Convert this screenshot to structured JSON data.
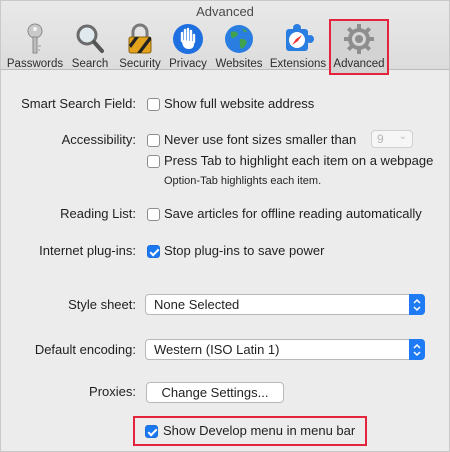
{
  "window": {
    "title": "Advanced"
  },
  "toolbar": {
    "items": [
      {
        "label": "Passwords",
        "icon": "key-icon"
      },
      {
        "label": "Search",
        "icon": "magnifier-icon"
      },
      {
        "label": "Security",
        "icon": "padlock-icon"
      },
      {
        "label": "Privacy",
        "icon": "hand-icon"
      },
      {
        "label": "Websites",
        "icon": "globe-icon"
      },
      {
        "label": "Extensions",
        "icon": "puzzle-compass-icon"
      },
      {
        "label": "Advanced",
        "icon": "gear-icon",
        "selected": true
      }
    ]
  },
  "settings": {
    "smart_search": {
      "label": "Smart Search Field:",
      "option": "Show full website address",
      "checked": false
    },
    "accessibility": {
      "label": "Accessibility:",
      "font_option": "Never use font sizes smaller than",
      "font_size_value": "9",
      "font_checked": false,
      "tab_option": "Press Tab to highlight each item on a webpage",
      "tab_checked": false,
      "tab_hint": "Option-Tab highlights each item."
    },
    "reading_list": {
      "label": "Reading List:",
      "option": "Save articles for offline reading automatically",
      "checked": false
    },
    "plugins": {
      "label": "Internet plug-ins:",
      "option": "Stop plug-ins to save power",
      "checked": true
    },
    "style_sheet": {
      "label": "Style sheet:",
      "value": "None Selected"
    },
    "encoding": {
      "label": "Default encoding:",
      "value": "Western (ISO Latin 1)"
    },
    "proxies": {
      "label": "Proxies:",
      "button": "Change Settings..."
    },
    "develop_menu": {
      "option": "Show Develop menu in menu bar",
      "checked": true
    }
  },
  "colors": {
    "accent": "#1a78f0",
    "highlight": "#e4233d"
  }
}
